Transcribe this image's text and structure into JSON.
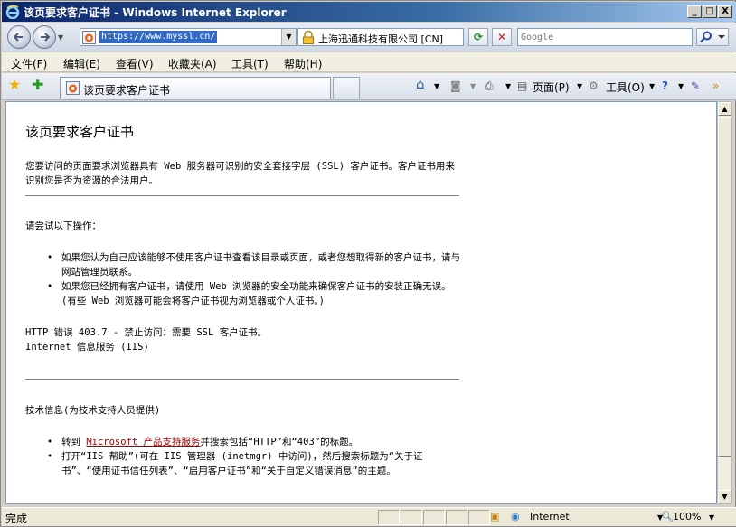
{
  "window": {
    "title": "该页要求客户证书 - Windows Internet Explorer",
    "minimize": "_",
    "maximize": "□",
    "close": "X"
  },
  "address": {
    "url": "https://www.myssl.cn/",
    "cert_label": "上海迅通科技有限公司 [CN]"
  },
  "search": {
    "placeholder": "Google"
  },
  "menu": [
    "文件(F)",
    "编辑(E)",
    "查看(V)",
    "收藏夹(A)",
    "工具(T)",
    "帮助(H)"
  ],
  "tab": {
    "label": "该页要求客户证书"
  },
  "command_bar": {
    "page": "页面(P)",
    "tools": "工具(O)"
  },
  "page": {
    "heading": "该页要求客户证书",
    "intro": "您要访问的页面要求浏览器具有 Web 服务器可识别的安全套接字层 (SSL) 客户证书。客户证书用来识别您是否为资源的合法用户。",
    "try_heading": "请尝试以下操作：",
    "try_items": [
      "如果您认为自己应该能够不使用客户证书查看该目录或页面，或者您想取得新的客户证书，请与网站管理员联系。",
      "如果您已经拥有客户证书，请使用 Web 浏览器的安全功能来确保客户证书的安装正确无误。(有些 Web 浏览器可能会将客户证书视为浏览器或个人证书。)"
    ],
    "error_line1": "HTTP 错误 403.7 - 禁止访问：需要 SSL 客户证书。",
    "error_line2": "Internet 信息服务 (IIS)",
    "tech_heading": "技术信息(为技术支持人员提供)",
    "tech_item1_prefix": "转到 ",
    "tech_item1_link": "Microsoft 产品支持服务",
    "tech_item1_suffix": "并搜索包括“HTTP”和“403”的标题。",
    "tech_item2": "打开“IIS 帮助”(可在 IIS 管理器 (inetmgr) 中访问)，然后搜索标题为“关于证书”、“使用证书信任列表”、“启用客户证书”和“关于自定义错误消息”的主题。"
  },
  "status": {
    "text": "完成",
    "zone": "Internet",
    "zoom": "100%"
  }
}
